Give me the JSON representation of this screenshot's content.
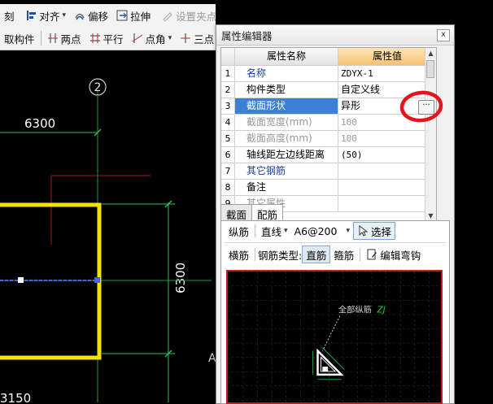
{
  "toolbar_top": {
    "cut_label": "刻",
    "align_label": "对齐",
    "offset_label": "偏移",
    "stretch_label": "拉伸",
    "set_vertex_label": "设置夹点"
  },
  "toolbar_second": {
    "pick_label": "取构件",
    "two_point_label": "两点",
    "parallel_label": "平行",
    "point_angle_label": "点角",
    "three_point_label": "三点"
  },
  "cad": {
    "axis_label": "2",
    "dim_top": "6300",
    "dim_right": "6300",
    "dim_bottom": "3150",
    "axis_label_partial": "A",
    "colors": {
      "column": "#f5e20b",
      "grid": "#1f9a3a",
      "dim": "#2fbf55",
      "red_line": "#b01515"
    }
  },
  "property_editor": {
    "title": "属性编辑器",
    "close_icon_label": "x",
    "header": {
      "name_col": "属性名称",
      "value_col": "属性值"
    },
    "rows": [
      {
        "num": "1",
        "name": "名称",
        "value": "ZDYX-1",
        "style": "blue"
      },
      {
        "num": "2",
        "name": "构件类型",
        "value": "自定义线",
        "style": "normal"
      },
      {
        "num": "3",
        "name": "截面形状",
        "value": "异形",
        "style": "selected"
      },
      {
        "num": "4",
        "name": "截面宽度(mm)",
        "value": "100",
        "style": "grey"
      },
      {
        "num": "5",
        "name": "截面高度(mm)",
        "value": "100",
        "style": "grey"
      },
      {
        "num": "6",
        "name": "轴线距左边线距离",
        "value": "(50)",
        "style": "normal"
      },
      {
        "num": "7",
        "name": "其它钢筋",
        "value": "",
        "style": "blue"
      },
      {
        "num": "8",
        "name": "备注",
        "value": "",
        "style": "normal"
      },
      {
        "num": "9",
        "name": "其它属性",
        "value": "",
        "style": "normal"
      }
    ],
    "ellipsis_label": "···"
  },
  "tabs": [
    {
      "label": "截面",
      "active": false
    },
    {
      "label": "配筋",
      "active": true
    }
  ],
  "rebar_panel": {
    "row1": {
      "longitudinal_label": "纵筋",
      "line_mode_label": "直线",
      "spec_value": "A6@200",
      "select_label": "选择"
    },
    "row2": {
      "transverse_label": "横筋",
      "rebar_type_label": "钢筋类型:",
      "straight_label": "直筋",
      "stirrup_label": "箍筋",
      "edit_bend_label": "编辑弯钩"
    },
    "canvas": {
      "all_long_label": "全部纵筋",
      "all_long_code": "ZJ"
    }
  }
}
